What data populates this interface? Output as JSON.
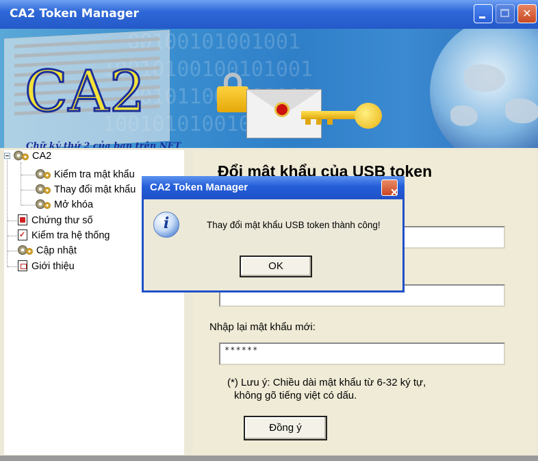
{
  "window": {
    "title": "CA2 Token Manager",
    "controls": {
      "minimize": "minimize",
      "maximize": "maximize",
      "close": "✕"
    }
  },
  "banner": {
    "logo_text": "CA2",
    "tagline": "Chữ ký thứ 2 của bạn trên NET"
  },
  "tree": {
    "root": "CA2",
    "children": [
      "Kiểm tra mật khẩu",
      "Thay đổi mật khẩu",
      "Mở khóa"
    ],
    "items": [
      "Chứng thư số",
      "Kiểm tra hệ thống",
      "Cập nhật",
      "Giới thiệu"
    ]
  },
  "panel": {
    "heading": "Đổi mật khẩu của USB token",
    "field_old_value": "",
    "field_new_value": "******",
    "confirm_label": "Nhập lại mật khẩu mới:",
    "confirm_value": "******",
    "note_line1": "(*) Lưu ý: Chiều dài mật khẩu từ 6-32 ký tự,",
    "note_line2": "không gõ tiếng việt có dấu.",
    "submit_label": "Đồng ý"
  },
  "dialog": {
    "title": "CA2 Token Manager",
    "close": "✕",
    "icon": "info-icon",
    "message": "Thay đổi mật khẩu USB token thành công!",
    "ok_label": "OK"
  },
  "colors": {
    "titlebar": "#2459c8",
    "dialog_border": "#1f50c8",
    "panel_bg": "#efebd6",
    "logo_yellow": "#f4e33a"
  }
}
